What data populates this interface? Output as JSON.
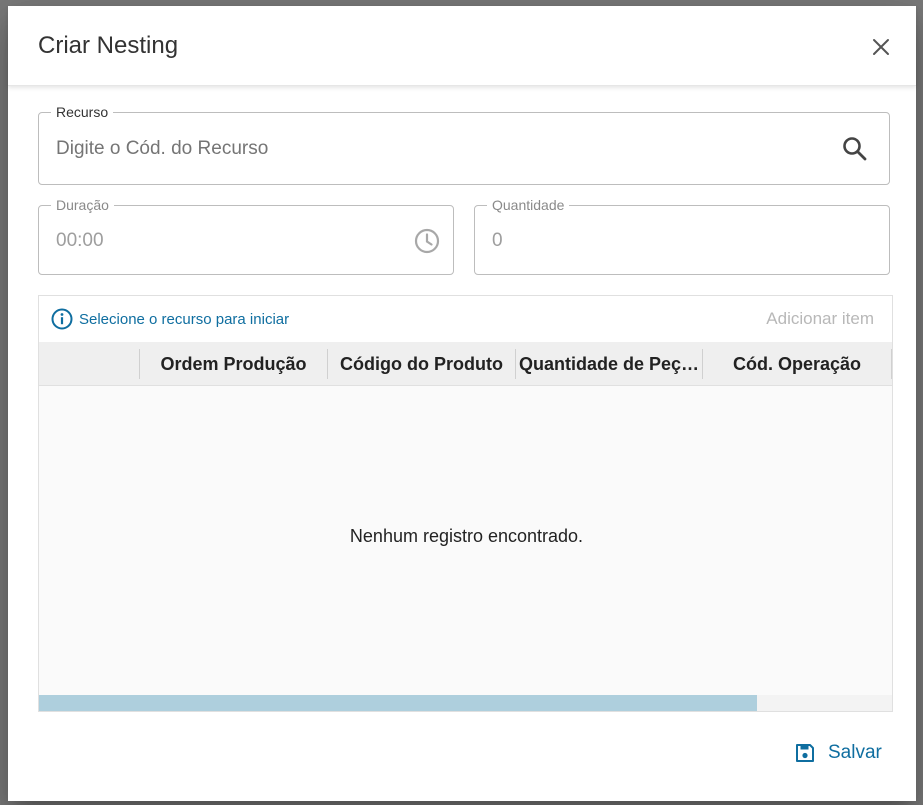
{
  "dialog": {
    "title": "Criar Nesting"
  },
  "recurso": {
    "label": "Recurso",
    "placeholder": "Digite o Cód. do Recurso"
  },
  "duracao": {
    "label": "Duração",
    "value": "00:00"
  },
  "quantidade": {
    "label": "Quantidade",
    "value": "0"
  },
  "grid": {
    "info_text": "Selecione o recurso para iniciar",
    "add_item_label": "Adicionar item",
    "columns": [
      "",
      "Ordem Produção",
      "Código do Produto",
      "Quantidade de Peç…",
      "Cód. Operação"
    ],
    "empty_message": "Nenhum registro encontrado."
  },
  "footer": {
    "save_label": "Salvar"
  },
  "colors": {
    "accent": "#0f6ea0",
    "disabled": "#b8b8b8",
    "scroll_thumb": "#aecfdd"
  },
  "icons": [
    "close-icon",
    "search-icon",
    "clock-icon",
    "info-icon",
    "save-icon"
  ]
}
